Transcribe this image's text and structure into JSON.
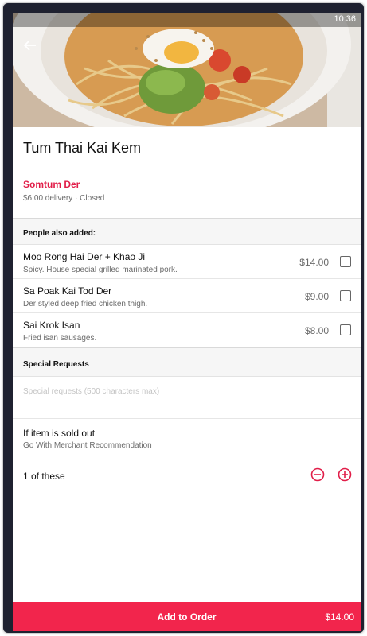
{
  "status_bar": {
    "time": "10:36"
  },
  "item": {
    "title": "Tum Thai Kai Kem",
    "merchant": "Somtum Der",
    "delivery_info": "$6.00 delivery · Closed",
    "image_icon": "papaya-salad-photo"
  },
  "addons": {
    "header": "People also added:",
    "items": [
      {
        "name": "Moo Rong Hai Der + Khao Ji",
        "description": "Spicy. House special grilled marinated pork.",
        "price": "$14.00",
        "checked": false
      },
      {
        "name": "Sa Poak Kai Tod Der",
        "description": "Der styled deep fried chicken thigh.",
        "price": "$9.00",
        "checked": false
      },
      {
        "name": "Sai Krok Isan",
        "description": "Fried isan sausages.",
        "price": "$8.00",
        "checked": false
      }
    ]
  },
  "special_requests": {
    "header": "Special Requests",
    "placeholder": "Special requests (500 characters max)"
  },
  "sold_out": {
    "label": "If item is sold out",
    "value": "Go With Merchant Recommendation"
  },
  "quantity": {
    "label": "1 of these"
  },
  "footer": {
    "button_label": "Add to Order",
    "total": "$14.00"
  },
  "colors": {
    "accent": "#f2254c",
    "merchant_text": "#e11d48"
  }
}
